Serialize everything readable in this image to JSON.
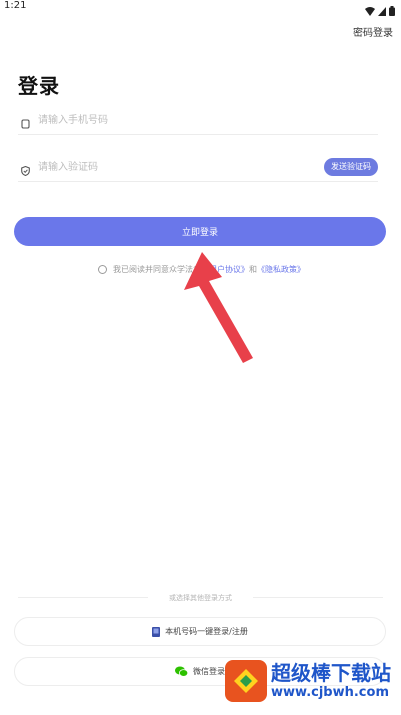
{
  "status_bar": {
    "time": "1:21"
  },
  "header": {
    "top_right_link": "密码登录"
  },
  "page_title": "登录",
  "form": {
    "phone_placeholder": "请输入手机号码",
    "code_placeholder": "请输入验证码",
    "send_code_label": "发送验证码",
    "login_button_label": "立即登录"
  },
  "agreement": {
    "prefix": "我已阅读并同意众学法考",
    "user_agreement": "《用户协议》",
    "and": "和",
    "privacy_policy": "《隐私政策》"
  },
  "other_methods": {
    "divider_label": "或选择其他登录方式",
    "one_key_label": "本机号码一键登录/注册",
    "wechat_label": "微信登录"
  },
  "watermark": {
    "title": "超级棒下载站",
    "url": "www.cjbwh.com"
  },
  "colors": {
    "accent": "#6a77ea",
    "arrow": "#e8404a",
    "wechat": "#2dc100"
  },
  "icons": [
    "phone-icon",
    "shield-icon",
    "device-icon",
    "wechat-icon",
    "wifi-icon",
    "battery-icon"
  ]
}
